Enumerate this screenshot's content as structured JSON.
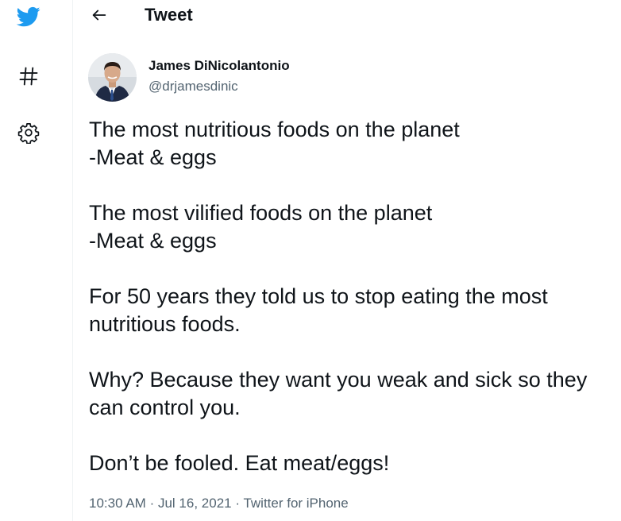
{
  "header": {
    "title": "Tweet"
  },
  "sidebar": {
    "icons": [
      "twitter-logo-icon",
      "explore-hash-icon",
      "settings-gear-icon"
    ],
    "brand_color": "#1d9bf0"
  },
  "author": {
    "name": "James DiNicolantonio",
    "handle": "@drjamesdinic"
  },
  "tweet": {
    "paragraphs": [
      "The most nutritious foods on the planet\n-Meat & eggs",
      "The most vilified foods on the planet\n-Meat & eggs",
      "For 50 years they told us to stop eating the most nutritious foods.",
      "Why? Because they want you weak and sick so they can control you.",
      "Don’t be fooled. Eat meat/eggs!"
    ],
    "time": "10:30 AM",
    "date": "Jul 16, 2021",
    "source": "Twitter for iPhone",
    "separator": "·"
  },
  "colors": {
    "text_primary": "#0f1419",
    "text_secondary": "#536471",
    "divider": "#eff3f4"
  }
}
